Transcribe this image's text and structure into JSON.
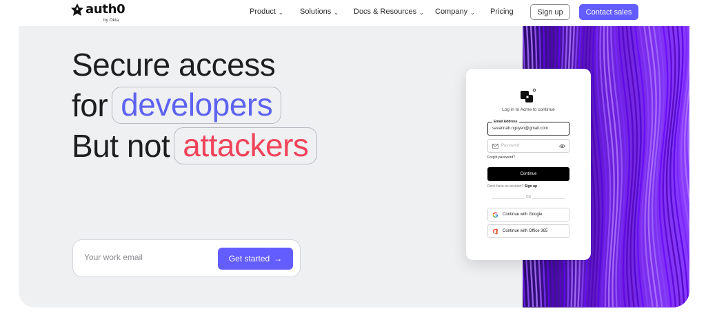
{
  "nav": {
    "logo_text": "auth0",
    "logo_sub": "by Okta",
    "items": [
      {
        "label": "Product",
        "has_dropdown": true
      },
      {
        "label": "Solutions",
        "has_dropdown": true
      },
      {
        "label": "Docs & Resources",
        "has_dropdown": true
      },
      {
        "label": "Company",
        "has_dropdown": true
      },
      {
        "label": "Pricing",
        "has_dropdown": false
      }
    ],
    "signup_label": "Sign up",
    "contact_label": "Contact sales",
    "chevron": "⌄"
  },
  "hero": {
    "line1": "Secure access",
    "line2_prefix": "for",
    "line2_pill": "developers",
    "line3_prefix": "But not",
    "line3_pill": "attackers",
    "email_placeholder": "Your work email",
    "cta_label": "Get started",
    "cta_arrow": "→"
  },
  "login_card": {
    "title": "Log in to Acme to continue",
    "email_label": "Email Address",
    "email_value": "savannah.nguyen@gmail.com",
    "password_placeholder": "Password",
    "forgot": "Forgot password?",
    "continue_label": "Continue",
    "no_account": "Don't have an account?",
    "signup_link": "Sign up",
    "or": "OR",
    "google_label": "Continue with Google",
    "office_label": "Continue with Office 365"
  },
  "colors": {
    "accent": "#635dff",
    "highlight_blue": "#5d62f0",
    "highlight_red": "#f0435a",
    "hero_bg": "#eff0f2",
    "art_purple": "#7b2ff7"
  }
}
